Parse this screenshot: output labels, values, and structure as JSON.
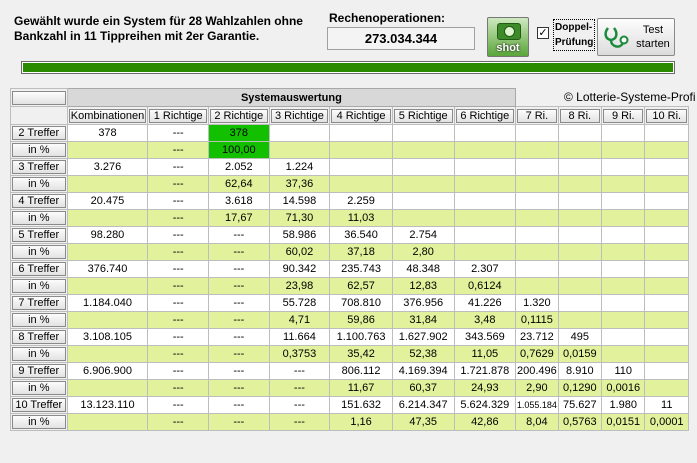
{
  "header": {
    "info_line1": "Gewählt wurde ein System für 28 Wahlzahlen ohne",
    "info_line2": "Bankzahl in 11 Tippreihen mit 2er Garantie.",
    "ops_label": "Rechenoperationen:",
    "ops_value": "273.034.344",
    "shot_label": "shot",
    "check_mark": "✓",
    "doppel_line1": "Doppel-",
    "doppel_line2": "Prüfung",
    "test_line1": "Test",
    "test_line2": "starten",
    "progress": 1.0
  },
  "table": {
    "title": "Systemauswertung",
    "copyright": "© Lotterie-Systeme-Profi",
    "columns": [
      "Kombinationen",
      "1 Richtige",
      "2 Richtige",
      "3 Richtige",
      "4 Richtige",
      "5 Richtige",
      "6 Richtige",
      "7 Ri.",
      "8 Ri.",
      "9 Ri.",
      "10 Ri."
    ],
    "rows": [
      {
        "label": "2 Treffer",
        "pct_label": "in %",
        "counts": [
          "378",
          "---",
          "378",
          "",
          "",
          "",
          "",
          "",
          "",
          "",
          ""
        ],
        "pcts": [
          "",
          "---",
          "100,00",
          "",
          "",
          "",
          "",
          "",
          "",
          "",
          ""
        ]
      },
      {
        "label": "3 Treffer",
        "pct_label": "in %",
        "counts": [
          "3.276",
          "---",
          "2.052",
          "1.224",
          "",
          "",
          "",
          "",
          "",
          "",
          ""
        ],
        "pcts": [
          "",
          "---",
          "62,64",
          "37,36",
          "",
          "",
          "",
          "",
          "",
          "",
          ""
        ]
      },
      {
        "label": "4 Treffer",
        "pct_label": "in %",
        "counts": [
          "20.475",
          "---",
          "3.618",
          "14.598",
          "2.259",
          "",
          "",
          "",
          "",
          "",
          ""
        ],
        "pcts": [
          "",
          "---",
          "17,67",
          "71,30",
          "11,03",
          "",
          "",
          "",
          "",
          "",
          ""
        ]
      },
      {
        "label": "5 Treffer",
        "pct_label": "in %",
        "counts": [
          "98.280",
          "---",
          "---",
          "58.986",
          "36.540",
          "2.754",
          "",
          "",
          "",
          "",
          ""
        ],
        "pcts": [
          "",
          "---",
          "---",
          "60,02",
          "37,18",
          "2,80",
          "",
          "",
          "",
          "",
          ""
        ]
      },
      {
        "label": "6 Treffer",
        "pct_label": "in %",
        "counts": [
          "376.740",
          "---",
          "---",
          "90.342",
          "235.743",
          "48.348",
          "2.307",
          "",
          "",
          "",
          ""
        ],
        "pcts": [
          "",
          "---",
          "---",
          "23,98",
          "62,57",
          "12,83",
          "0,6124",
          "",
          "",
          "",
          ""
        ]
      },
      {
        "label": "7 Treffer",
        "pct_label": "in %",
        "counts": [
          "1.184.040",
          "---",
          "---",
          "55.728",
          "708.810",
          "376.956",
          "41.226",
          "1.320",
          "",
          "",
          ""
        ],
        "pcts": [
          "",
          "---",
          "---",
          "4,71",
          "59,86",
          "31,84",
          "3,48",
          "0,1115",
          "",
          "",
          ""
        ]
      },
      {
        "label": "8 Treffer",
        "pct_label": "in %",
        "counts": [
          "3.108.105",
          "---",
          "---",
          "11.664",
          "1.100.763",
          "1.627.902",
          "343.569",
          "23.712",
          "495",
          "",
          ""
        ],
        "pcts": [
          "",
          "---",
          "---",
          "0,3753",
          "35,42",
          "52,38",
          "11,05",
          "0,7629",
          "0,0159",
          "",
          ""
        ]
      },
      {
        "label": "9 Treffer",
        "pct_label": "in %",
        "counts": [
          "6.906.900",
          "---",
          "---",
          "---",
          "806.112",
          "4.169.394",
          "1.721.878",
          "200.496",
          "8.910",
          "110",
          ""
        ],
        "pcts": [
          "",
          "---",
          "---",
          "---",
          "11,67",
          "60,37",
          "24,93",
          "2,90",
          "0,1290",
          "0,0016",
          ""
        ]
      },
      {
        "label": "10 Treffer",
        "pct_label": "in %",
        "counts": [
          "13.123.110",
          "---",
          "---",
          "---",
          "151.632",
          "6.214.347",
          "5.624.329",
          "1.055.184",
          "75.627",
          "1.980",
          "11"
        ],
        "pcts": [
          "",
          "---",
          "---",
          "---",
          "1,16",
          "47,35",
          "42,86",
          "8,04",
          "0,5763",
          "0,0151",
          "0,0001"
        ]
      }
    ]
  },
  "colors": {
    "highlight": "#12c000",
    "pct_row": "#e2f29c",
    "progress": "#2a8a00"
  }
}
